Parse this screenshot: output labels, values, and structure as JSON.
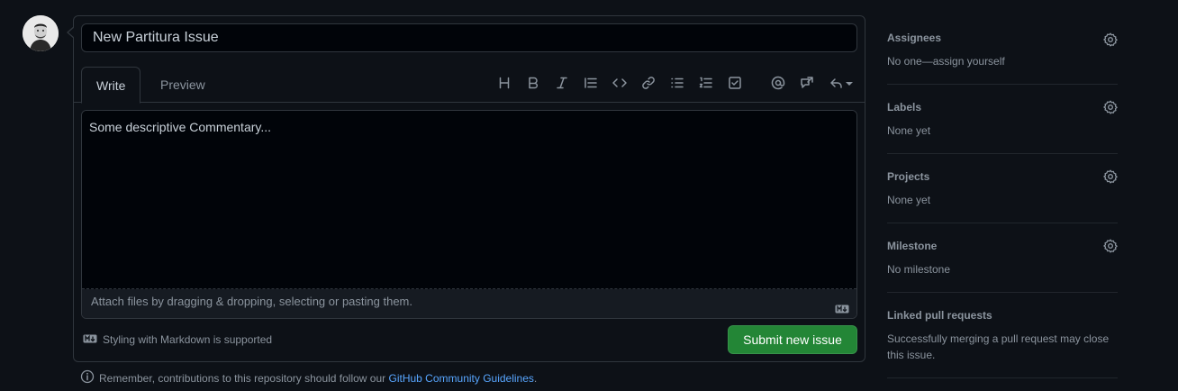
{
  "issue": {
    "title_value": "New Partitura Issue",
    "body_value": "Some descriptive Commentary..."
  },
  "tabs": [
    "Write",
    "Preview"
  ],
  "toolbar": {
    "heading_label": "H",
    "icons": [
      "heading-icon",
      "bold-icon",
      "italic-icon",
      "quote-icon",
      "code-icon",
      "link-icon",
      "unordered-list-icon",
      "ordered-list-icon",
      "task-list-icon",
      "mention-icon",
      "reference-icon",
      "reply-icon"
    ]
  },
  "editor": {
    "drop_text": "Attach files by dragging & dropping, selecting or pasting them."
  },
  "footer": {
    "markdown_note": "Styling with Markdown is supported",
    "submit_label": "Submit new issue",
    "reminder_text": "Remember, contributions to this repository should follow our",
    "guidelines_link": "GitHub Community Guidelines",
    "reminder_end": "."
  },
  "sidebar": {
    "sections": [
      {
        "heading": "Assignees",
        "value": "No one—assign yourself",
        "has_gear": true
      },
      {
        "heading": "Labels",
        "value": "None yet",
        "has_gear": true
      },
      {
        "heading": "Projects",
        "value": "None yet",
        "has_gear": true
      },
      {
        "heading": "Milestone",
        "value": "No milestone",
        "has_gear": true
      },
      {
        "heading": "Linked pull requests",
        "value": "Successfully merging a pull request may close this issue.",
        "has_gear": false
      }
    ]
  },
  "colors": {
    "background": "#0d1117",
    "submit": "#238636",
    "link": "#58a6ff",
    "muted": "#8b949e"
  }
}
